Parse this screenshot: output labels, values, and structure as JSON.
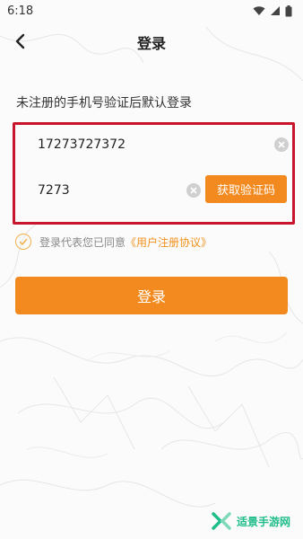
{
  "status_bar": {
    "time": "6:18",
    "icons": [
      "wifi-icon",
      "cellular-icon",
      "battery-icon"
    ]
  },
  "nav": {
    "back_icon": "chevron-left-icon",
    "title": "登录"
  },
  "subtitle": "未注册的手机号验证后默认登录",
  "form": {
    "phone_value": "17273727372",
    "code_value": "7273",
    "clear_icon": "clear-icon",
    "get_code_label": "获取验证码"
  },
  "agreement": {
    "check_icon": "check-circle-icon",
    "text": "登录代表您已同意",
    "link": "《用户注册协议》"
  },
  "login_label": "登录",
  "watermark": {
    "logo_icon": "logo-icon",
    "text": "适景手游网"
  },
  "colors": {
    "accent": "#f28a1f",
    "highlight_border": "#c8152b",
    "link": "#f0911c",
    "watermark": "#1fbd8a"
  }
}
